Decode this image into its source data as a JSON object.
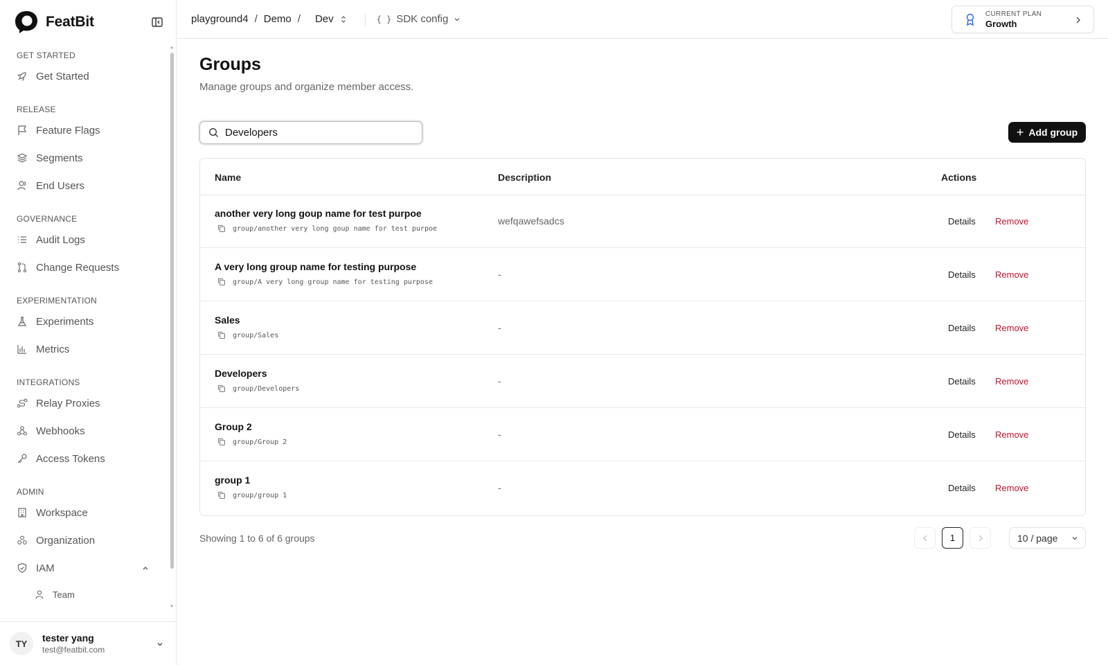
{
  "brand": {
    "name": "FeatBit"
  },
  "sidebar": {
    "sections": [
      {
        "title": "GET STARTED",
        "items": [
          {
            "label": "Get Started",
            "icon": "rocket-icon"
          }
        ]
      },
      {
        "title": "RELEASE",
        "items": [
          {
            "label": "Feature Flags",
            "icon": "flag-icon"
          },
          {
            "label": "Segments",
            "icon": "layers-icon"
          },
          {
            "label": "End Users",
            "icon": "users-icon"
          }
        ]
      },
      {
        "title": "GOVERNANCE",
        "items": [
          {
            "label": "Audit Logs",
            "icon": "list-icon"
          },
          {
            "label": "Change Requests",
            "icon": "git-pull-request-icon"
          }
        ]
      },
      {
        "title": "EXPERIMENTATION",
        "items": [
          {
            "label": "Experiments",
            "icon": "flask-icon"
          },
          {
            "label": "Metrics",
            "icon": "bar-chart-icon"
          }
        ]
      },
      {
        "title": "INTEGRATIONS",
        "items": [
          {
            "label": "Relay Proxies",
            "icon": "route-icon"
          },
          {
            "label": "Webhooks",
            "icon": "webhook-icon"
          },
          {
            "label": "Access Tokens",
            "icon": "key-icon"
          }
        ]
      },
      {
        "title": "ADMIN",
        "items": [
          {
            "label": "Workspace",
            "icon": "building-icon"
          },
          {
            "label": "Organization",
            "icon": "org-icon"
          },
          {
            "label": "IAM",
            "icon": "shield-icon"
          }
        ]
      }
    ],
    "iam_sub": {
      "label": "Team",
      "icon": "user-icon"
    }
  },
  "user": {
    "initials": "TY",
    "name": "tester yang",
    "email": "test@featbit.com"
  },
  "topbar": {
    "crumbs": [
      "playground4",
      "Demo",
      "Dev"
    ],
    "sep": "/",
    "sdk_braces": "{ }",
    "sdk_label": "SDK config",
    "plan_label": "CURRENT PLAN",
    "plan_name": "Growth"
  },
  "page": {
    "title": "Groups",
    "subtitle": "Manage groups and organize member access.",
    "search_value": "Developers",
    "add_label": "Add group",
    "add_plus": "+"
  },
  "table": {
    "headers": {
      "name": "Name",
      "description": "Description",
      "actions": "Actions"
    },
    "rows": [
      {
        "name": "another very long goup name for test purpoe",
        "key": "group/another very long goup name for test purpoe",
        "description": "wefqawefsadcs"
      },
      {
        "name": "A very long group name for testing purpose",
        "key": "group/A very long group name for testing purpose",
        "description": "-"
      },
      {
        "name": "Sales",
        "key": "group/Sales",
        "description": "-"
      },
      {
        "name": "Developers",
        "key": "group/Developers",
        "description": "-"
      },
      {
        "name": "Group 2",
        "key": "group/Group 2",
        "description": "-"
      },
      {
        "name": "group 1",
        "key": "group/group 1",
        "description": "-"
      }
    ],
    "details_label": "Details",
    "remove_label": "Remove"
  },
  "pagination": {
    "summary": "Showing 1 to 6 of 6 groups",
    "current_page": "1",
    "per_page": "10 / page"
  },
  "colors": {
    "remove": "#c8102e",
    "primary_button": "#111111"
  }
}
